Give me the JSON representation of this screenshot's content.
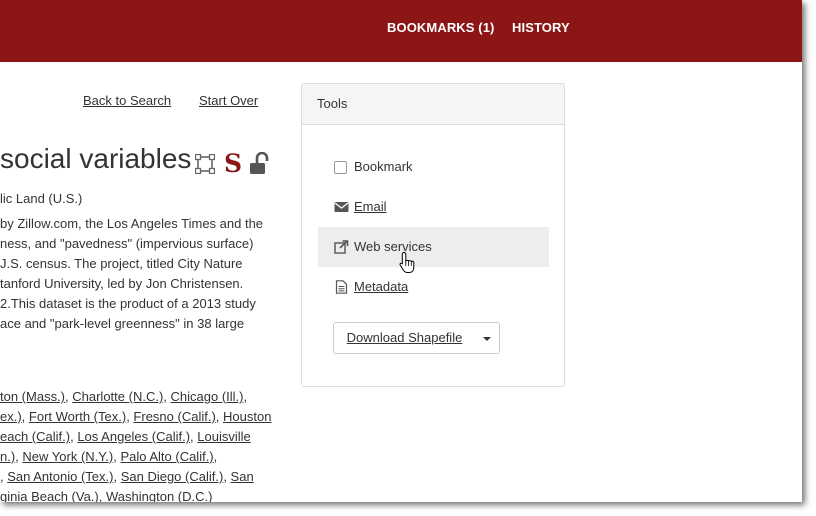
{
  "nav": {
    "bookmarks": "BOOKMARKS (1)",
    "history": "HISTORY"
  },
  "links": {
    "back_to_search": "Back to Search",
    "start_over": "Start Over"
  },
  "record": {
    "title_visible": "social variables",
    "subject_fragment": "lic Land (U.S.)",
    "description_lines": [
      "by Zillow.com, the Los Angeles Times and the",
      "ness, and \"pavedness\" (impervious surface)",
      "J.S. census. The project, titled City Nature",
      "tanford University, led by Jon Christensen.",
      "2.This dataset is the product of a 2013 study",
      "ace and \"park-level greenness\" in 38 large"
    ],
    "places_lines": [
      [
        {
          "text": "ton (Mass.)",
          "link": true
        },
        {
          "text": ", ",
          "link": false
        },
        {
          "text": "Charlotte (N.C.)",
          "link": true
        },
        {
          "text": ", ",
          "link": false
        },
        {
          "text": "Chicago (Ill.)",
          "link": true
        },
        {
          "text": ",",
          "link": false
        }
      ],
      [
        {
          "text": "ex.)",
          "link": true
        },
        {
          "text": ", ",
          "link": false
        },
        {
          "text": "Fort Worth (Tex.)",
          "link": true
        },
        {
          "text": ", ",
          "link": false
        },
        {
          "text": "Fresno (Calif.)",
          "link": true
        },
        {
          "text": ", ",
          "link": false
        },
        {
          "text": "Houston",
          "link": true
        }
      ],
      [
        {
          "text": "each (Calif.)",
          "link": true
        },
        {
          "text": ", ",
          "link": false
        },
        {
          "text": "Los Angeles (Calif.)",
          "link": true
        },
        {
          "text": ", ",
          "link": false
        },
        {
          "text": "Louisville",
          "link": true
        }
      ],
      [
        {
          "text": "n.)",
          "link": true
        },
        {
          "text": ", ",
          "link": false
        },
        {
          "text": "New York (N.Y.)",
          "link": true
        },
        {
          "text": ", ",
          "link": false
        },
        {
          "text": "Palo Alto (Calif.)",
          "link": true
        },
        {
          "text": ",",
          "link": false
        }
      ],
      [
        {
          "text": ", ",
          "link": false
        },
        {
          "text": "San Antonio (Tex.)",
          "link": true
        },
        {
          "text": ", ",
          "link": false
        },
        {
          "text": "San Diego (Calif.)",
          "link": true
        },
        {
          "text": ", ",
          "link": false
        },
        {
          "text": "San",
          "link": true
        }
      ],
      [
        {
          "text": "ginia Beach (Va.)",
          "link": true
        },
        {
          "text": ", ",
          "link": false
        },
        {
          "text": "Washington (D.C.)",
          "link": true
        }
      ]
    ]
  },
  "tools": {
    "heading": "Tools",
    "bookmark_label": "Bookmark",
    "email_label": "Email",
    "web_services_label": "Web services",
    "metadata_label": "Metadata",
    "download_label": "Download Shapefile"
  },
  "icons": {
    "bbox": "bounding-box-icon",
    "stanford": "stanford-logo-icon",
    "lock": "unlock-icon",
    "envelope": "envelope-icon",
    "external": "external-link-icon",
    "document": "document-icon",
    "caret": "caret-down-icon",
    "cursor": "hand-pointer-icon"
  },
  "colors": {
    "brand": "#8c1515",
    "text": "#333333",
    "panel_border": "#dcdcdc",
    "highlight": "#ededed"
  },
  "stanford_glyph": "S"
}
